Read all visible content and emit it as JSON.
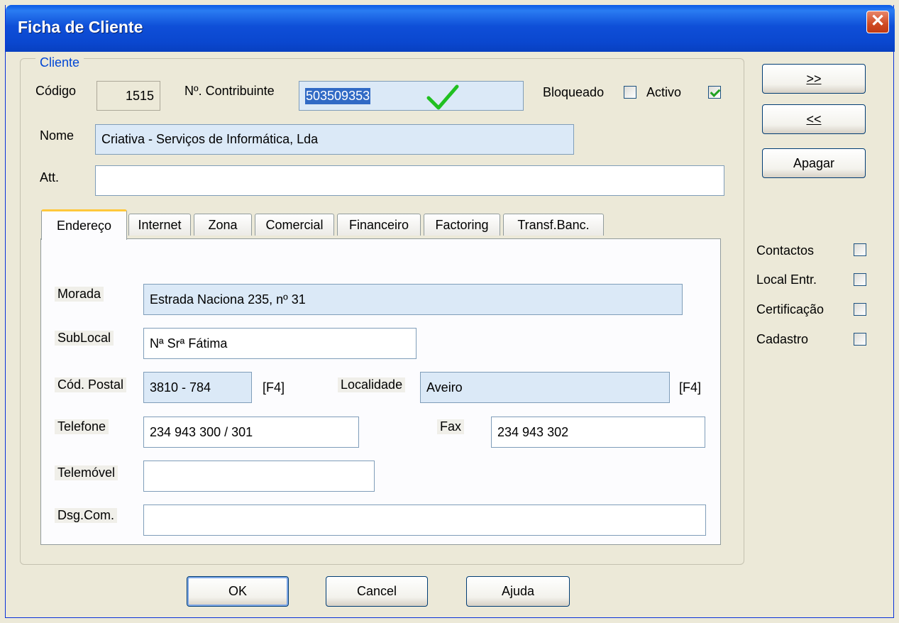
{
  "window": {
    "title": "Ficha de Cliente",
    "close_glyph": "✕"
  },
  "cliente": {
    "legend": "Cliente",
    "codigo_label": "Código",
    "codigo_value": "1515",
    "contribuinte_label": "Nº. Contribuinte",
    "contribuinte_value": "503509353",
    "valid_icon": "check-icon",
    "bloqueado_label": "Bloqueado",
    "bloqueado_checked": false,
    "activo_label": "Activo",
    "activo_checked": true,
    "nome_label": "Nome",
    "nome_value": "Criativa - Serviços de Informática, Lda",
    "att_label": "Att.",
    "att_value": ""
  },
  "tabs": [
    {
      "label": "Endereço",
      "active": true
    },
    {
      "label": "Internet"
    },
    {
      "label": "Zona"
    },
    {
      "label": "Comercial"
    },
    {
      "label": "Financeiro"
    },
    {
      "label": "Factoring"
    },
    {
      "label": "Transf.Banc."
    }
  ],
  "endereco": {
    "morada_label": "Morada",
    "morada_value": "Estrada Naciona 235, nº 31",
    "sublocal_label": "SubLocal",
    "sublocal_value": "Nª Srª Fátima",
    "cod_postal_label": "Cód. Postal",
    "cod_postal_value": "3810 - 784",
    "f4_1": "[F4]",
    "localidade_label": "Localidade",
    "localidade_value": "Aveiro",
    "f4_2": "[F4]",
    "telefone_label": "Telefone",
    "telefone_value": "234 943 300 / 301",
    "fax_label": "Fax",
    "fax_value": "234 943 302",
    "telemovel_label": "Telemóvel",
    "telemovel_value": "",
    "dsg_com_label": "Dsg.Com.",
    "dsg_com_value": ""
  },
  "side_buttons": {
    "next": ">>",
    "prev": "<<",
    "apagar": "Apagar"
  },
  "side_checks": [
    {
      "label": "Contactos",
      "checked": false
    },
    {
      "label": "Local Entr.",
      "checked": false
    },
    {
      "label": "Certificação",
      "checked": false
    },
    {
      "label": "Cadastro",
      "checked": false
    }
  ],
  "footer": {
    "ok": "OK",
    "cancel": "Cancel",
    "ajuda": "Ajuda"
  },
  "colors": {
    "title_bar": "#0a47cf",
    "field_highlight": "#dbe9f7",
    "tab_active_accent": "#ffc83c",
    "check_green": "#21a121"
  }
}
